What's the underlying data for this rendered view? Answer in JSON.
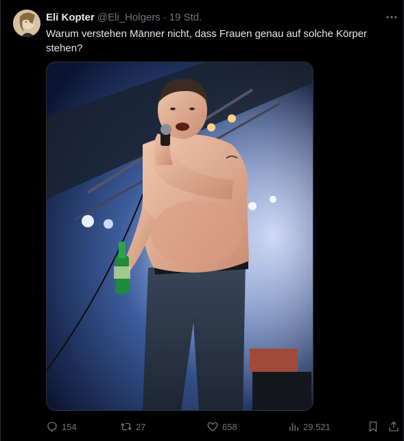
{
  "tweet": {
    "author": {
      "display_name": "Eli Kopter",
      "handle": "@Eli_Holgers",
      "separator": "·",
      "time": "19 Std."
    },
    "more_icon": "ellipsis-icon",
    "text": "Warum verstehen Männer nicht, dass Frauen genau auf solche Körper stehen?",
    "media": {
      "kind": "photo",
      "description_icon": "photo"
    },
    "actions": {
      "reply_count": "154",
      "retweet_count": "27",
      "like_count": "658",
      "view_count": "29.521"
    }
  },
  "colors": {
    "background": "#000000",
    "text_primary": "#e7e9ea",
    "text_secondary": "#71767b",
    "border": "#2f3336"
  }
}
